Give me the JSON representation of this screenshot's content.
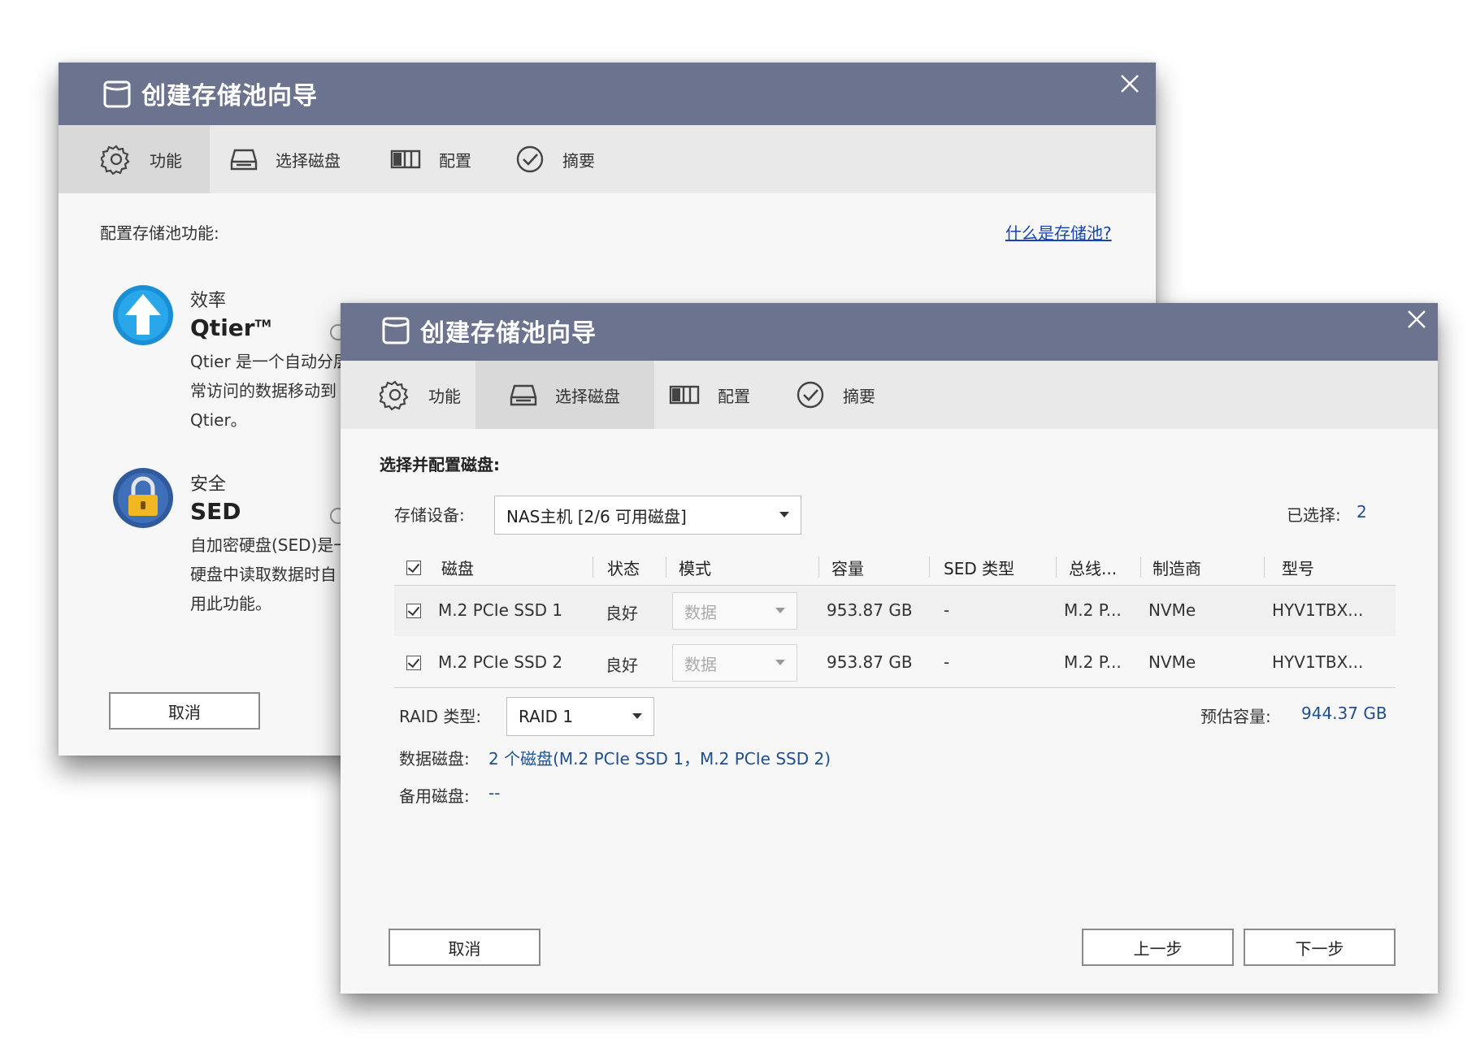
{
  "back_dialog": {
    "title": "创建存储池向导",
    "steps": [
      "功能",
      "选择磁盘",
      "配置",
      "摘要"
    ],
    "section_title": "配置存储池功能:",
    "help_link": "什么是存储池?",
    "features": [
      {
        "category": "效率",
        "name": "Qtier",
        "trademark": "TM",
        "lines": [
          "Qtier 是一个自动分层",
          "常访问的数据移动到",
          "Qtier。"
        ]
      },
      {
        "category": "安全",
        "name": "SED",
        "lines": [
          "自加密硬盘(SED)是一",
          "硬盘中读取数据时自",
          "用此功能。"
        ]
      }
    ],
    "cancel_label": "取消"
  },
  "front_dialog": {
    "title": "创建存储池向导",
    "steps": [
      "功能",
      "选择磁盘",
      "配置",
      "摘要"
    ],
    "section_title": "选择并配置磁盘:",
    "storage_device_label": "存储设备:",
    "storage_device_value": "NAS主机 [2/6 可用磁盘]",
    "selected_label": "已选择:",
    "selected_count": "2",
    "table": {
      "columns": [
        "磁盘",
        "状态",
        "模式",
        "容量",
        "SED 类型",
        "总线...",
        "制造商",
        "型号"
      ],
      "rows": [
        {
          "disk": "M.2 PCIe SSD 1",
          "status": "良好",
          "mode": "数据",
          "capacity": "953.87 GB",
          "sed": "-",
          "bus": "M.2 P...",
          "vendor": "NVMe",
          "model": "HYV1TBX..."
        },
        {
          "disk": "M.2 PCIe SSD 2",
          "status": "良好",
          "mode": "数据",
          "capacity": "953.87 GB",
          "sed": "-",
          "bus": "M.2 P...",
          "vendor": "NVMe",
          "model": "HYV1TBX..."
        }
      ]
    },
    "raid_label": "RAID 类型:",
    "raid_value": "RAID 1",
    "est_capacity_label": "预估容量:",
    "est_capacity_value": "944.37 GB",
    "data_disks_label": "数据磁盘:",
    "data_disks_value": "2 个磁盘(M.2 PCIe SSD 1，M.2 PCIe SSD 2)",
    "spare_disks_label": "备用磁盘:",
    "spare_disks_value": "--",
    "cancel_label": "取消",
    "prev_label": "上一步",
    "next_label": "下一步"
  },
  "colors": {
    "title_bar": "#6b738e",
    "accent_blue": "#1f4f8f",
    "link": "#1a44b0"
  }
}
